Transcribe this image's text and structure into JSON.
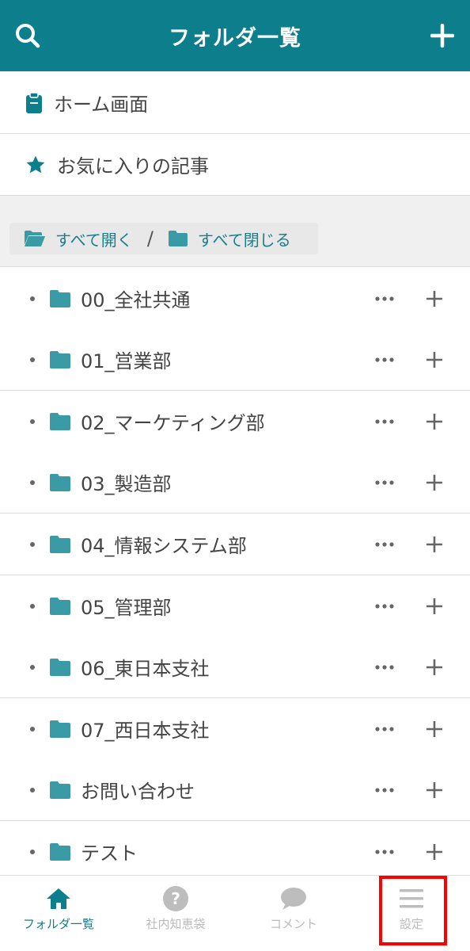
{
  "header": {
    "title": "フォルダ一覧",
    "search_icon": "search-icon",
    "add_icon": "plus-icon",
    "bg_color": "#0d7f8c"
  },
  "links": [
    {
      "label": "ホーム画面",
      "icon": "clipboard-icon"
    },
    {
      "label": "お気に入りの記事",
      "icon": "star-icon"
    }
  ],
  "toggles": {
    "expand_all": "すべて開く",
    "separator": "/",
    "collapse_all": "すべて閉じる"
  },
  "folders": [
    {
      "name": "00_全社共通"
    },
    {
      "name": "01_営業部"
    },
    {
      "name": "02_マーケティング部"
    },
    {
      "name": "03_製造部"
    },
    {
      "name": "04_情報システム部"
    },
    {
      "name": "05_管理部"
    },
    {
      "name": "06_東日本支社"
    },
    {
      "name": "07_西日本支社"
    },
    {
      "name": "お問い合わせ"
    },
    {
      "name": "テスト"
    }
  ],
  "tabbar": {
    "tabs": [
      {
        "label": "フォルダ一覧",
        "icon": "home-icon",
        "active": true
      },
      {
        "label": "社内知恵袋",
        "icon": "question-icon",
        "active": false
      },
      {
        "label": "コメント",
        "icon": "chat-bubble-icon",
        "active": false
      },
      {
        "label": "設定",
        "icon": "menu-icon",
        "active": false
      }
    ]
  }
}
